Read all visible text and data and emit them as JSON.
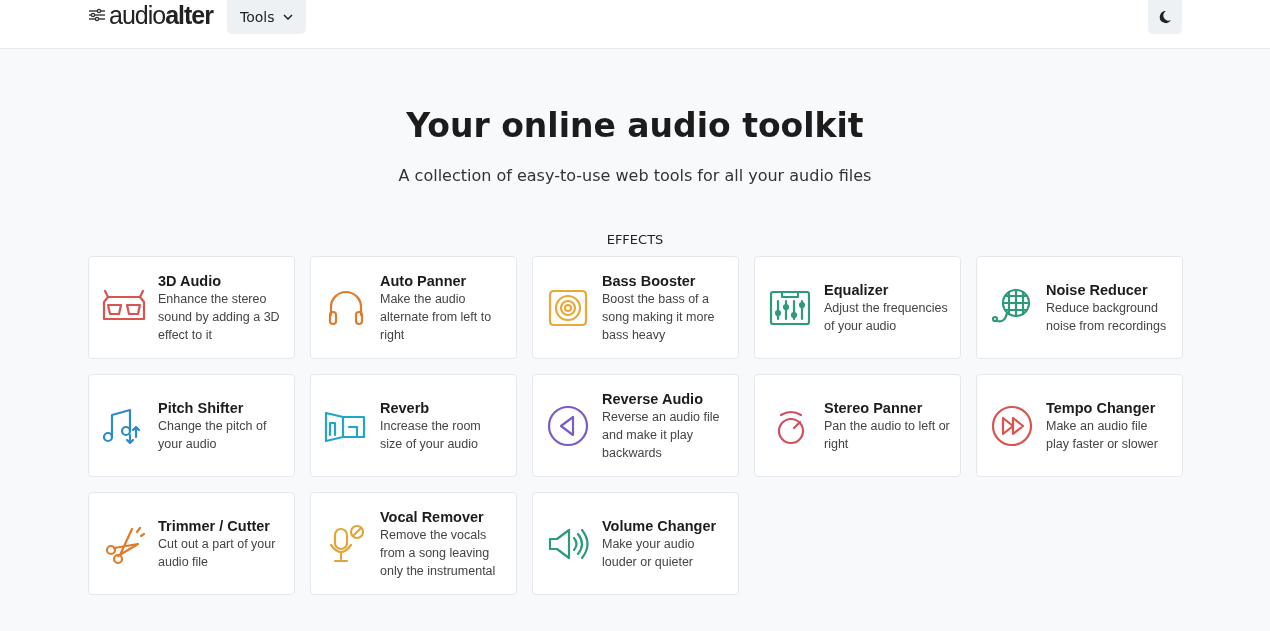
{
  "header": {
    "logo": "audio**alter**",
    "menu_button": "Tools"
  },
  "hero": {
    "title": "Your online audio toolkit",
    "subtitle": "A collection of easy-to-use web tools for all your audio files"
  },
  "section": {
    "heading": "EFFECTS"
  },
  "tools": [
    {
      "kind": "glasses",
      "color": "#d9534f",
      "title": "3D Audio",
      "description": "Enhance the stereo sound by adding a 3D effect to it"
    },
    {
      "kind": "headphones",
      "color": "#e07b2a",
      "title": "Auto Panner",
      "description": "Make the audio alternate from left to right"
    },
    {
      "kind": "speaker",
      "color": "#e8a93a",
      "title": "Bass Booster",
      "description": "Boost the bass of a song making it more bass heavy"
    },
    {
      "kind": "equalizer",
      "color": "#2e9a7a",
      "title": "Equalizer",
      "description": "Adjust the frequencies of your audio"
    },
    {
      "kind": "microphone",
      "color": "#2e9a7a",
      "title": "Noise Reducer",
      "description": "Reduce background noise from recordings"
    },
    {
      "kind": "notes",
      "color": "#2d8bc8",
      "title": "Pitch Shifter",
      "description": "Change the pitch of your audio"
    },
    {
      "kind": "room",
      "color": "#22a6c8",
      "title": "Reverb",
      "description": "Increase the room size of your audio"
    },
    {
      "kind": "reverse",
      "color": "#7a5cc8",
      "title": "Reverse Audio",
      "description": "Reverse an audio file and make it play backwards"
    },
    {
      "kind": "knob",
      "color": "#d0505f",
      "title": "Stereo Panner",
      "description": "Pan the audio to left or right"
    },
    {
      "kind": "forward",
      "color": "#d9534f",
      "title": "Tempo Changer",
      "description": "Make an audio file play faster or slower"
    },
    {
      "kind": "scissors",
      "color": "#e07b2a",
      "title": "Trimmer / Cutter",
      "description": "Cut out a part of your audio file"
    },
    {
      "kind": "vocal",
      "color": "#e0a63a",
      "title": "Vocal Remover",
      "description": "Remove the vocals from a song leaving only the instrumental"
    },
    {
      "kind": "volume",
      "color": "#2e9a7a",
      "title": "Volume Changer",
      "description": "Make your audio louder or quieter"
    }
  ]
}
